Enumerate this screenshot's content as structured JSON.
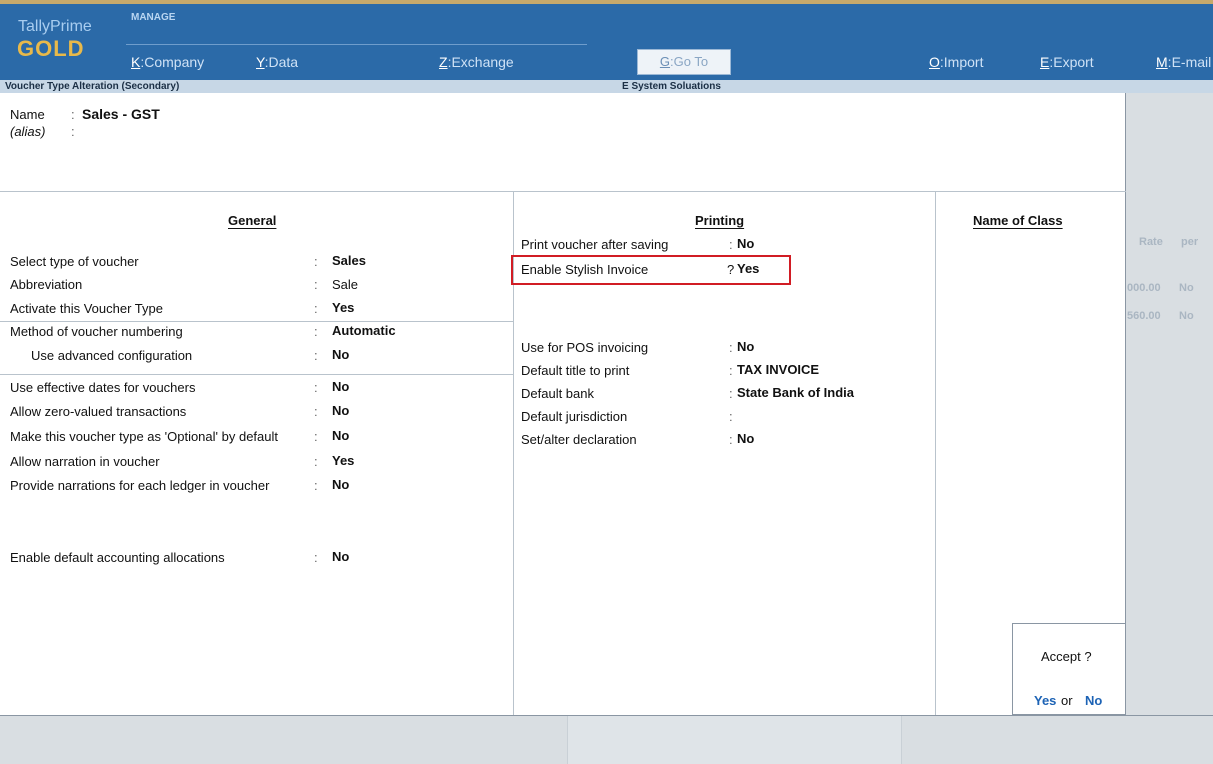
{
  "app": {
    "name": "TallyPrime",
    "edition": "GOLD"
  },
  "topbar": {
    "section": "MANAGE",
    "menus": [
      {
        "key": "K",
        "label": "Company"
      },
      {
        "key": "Y",
        "label": "Data"
      },
      {
        "key": "Z",
        "label": "Exchange"
      },
      {
        "key": "G",
        "label": "Go To"
      },
      {
        "key": "O",
        "label": "Import"
      },
      {
        "key": "E",
        "label": "Export"
      },
      {
        "key": "M",
        "label": "E-mail"
      }
    ]
  },
  "titlebar": {
    "screen": "Voucher Type Alteration (Secondary)",
    "company": "E System Soluations"
  },
  "header": {
    "name_label": "Name",
    "name_value": "Sales - GST",
    "alias_label": "(alias)",
    "alias_value": ""
  },
  "general": {
    "title": "General",
    "rows": [
      {
        "label": "Select type of voucher",
        "value": "Sales"
      },
      {
        "label": "Abbreviation",
        "value": "Sale"
      },
      {
        "label": "Activate this Voucher Type",
        "value": "Yes"
      },
      {
        "label": "Method of voucher numbering",
        "value": "Automatic"
      },
      {
        "label": "Use advanced configuration",
        "value": "No"
      },
      {
        "label": "Use effective dates for vouchers",
        "value": "No"
      },
      {
        "label": "Allow zero-valued transactions",
        "value": "No"
      },
      {
        "label": "Make this voucher type as 'Optional' by default",
        "value": "No"
      },
      {
        "label": "Allow narration in voucher",
        "value": "Yes"
      },
      {
        "label": "Provide narrations for each ledger in voucher",
        "value": "No"
      },
      {
        "label": "Enable default accounting allocations",
        "value": "No"
      }
    ]
  },
  "printing": {
    "title": "Printing",
    "rows": [
      {
        "label": "Print voucher after saving",
        "value": "No"
      },
      {
        "label": "Enable Stylish Invoice",
        "value": "Yes",
        "prompt": "?"
      },
      {
        "label": "Use for POS invoicing",
        "value": "No"
      },
      {
        "label": "Default title to print",
        "value": "TAX INVOICE"
      },
      {
        "label": "Default bank",
        "value": "State Bank of India"
      },
      {
        "label": "Default jurisdiction",
        "value": ""
      },
      {
        "label": "Set/alter declaration",
        "value": "No"
      }
    ]
  },
  "class": {
    "title": "Name of Class"
  },
  "background": {
    "rate_header": "Rate",
    "per_header": "per",
    "rows": [
      {
        "rate": "000.00",
        "per": "No"
      },
      {
        "rate": "560.00",
        "per": "No"
      }
    ]
  },
  "accept": {
    "question": "Accept ?",
    "yes": "Yes",
    "or": "or",
    "no": "No"
  },
  "colors": {
    "topbar": "#2b6aa8",
    "edition": "#e8b94a",
    "highlight": "#d11c24",
    "accept_link": "#1d63b5"
  }
}
